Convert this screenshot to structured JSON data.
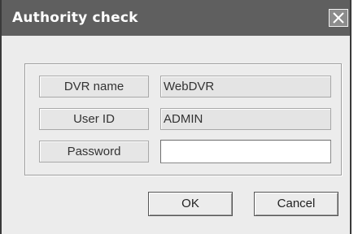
{
  "dialog": {
    "title": "Authority check",
    "close_icon": "close-icon"
  },
  "fields": {
    "dvr_name_label": "DVR name",
    "dvr_name_value": "WebDVR",
    "user_id_label": "User ID",
    "user_id_value": "ADMIN",
    "password_label": "Password",
    "password_value": ""
  },
  "buttons": {
    "ok_label": "OK",
    "cancel_label": "Cancel"
  }
}
